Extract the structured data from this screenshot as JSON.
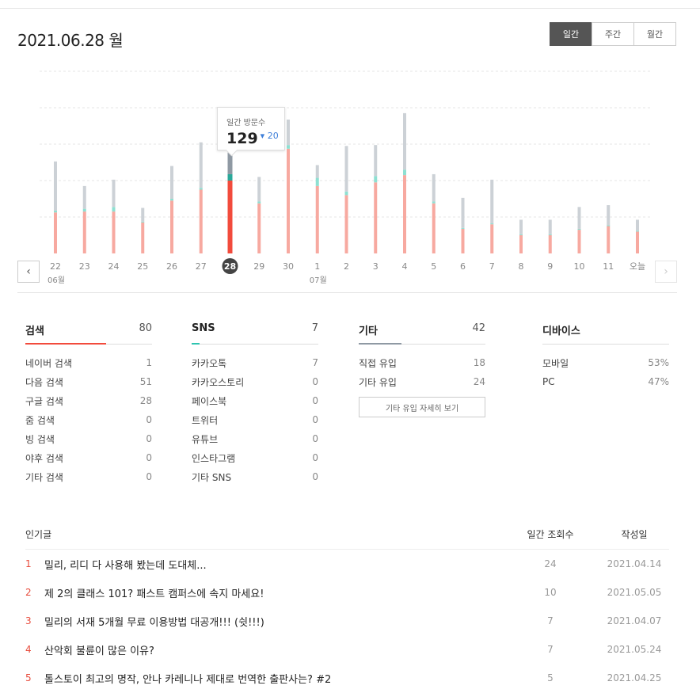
{
  "header": {
    "date_title": "2021.06.28 월",
    "periods": [
      "일간",
      "주간",
      "월간"
    ],
    "active_period": 0
  },
  "colors": {
    "search": "#f7a9a0",
    "search_selected": "#f24b3c",
    "sns": "#8ee0d2",
    "sns_selected": "#2aa89a",
    "other": "#ccd1d6",
    "other_selected": "#8f99a3",
    "grid": "#e6e6e6"
  },
  "tooltip": {
    "label": "일간 방문수",
    "value": "129",
    "change": "20",
    "change_arrow": "▾"
  },
  "chart_data": {
    "type": "bar",
    "stacked": true,
    "categories": [
      "22",
      "23",
      "24",
      "25",
      "26",
      "27",
      "28",
      "29",
      "30",
      "1",
      "2",
      "3",
      "4",
      "5",
      "6",
      "7",
      "8",
      "9",
      "10",
      "11",
      "오늘"
    ],
    "month_labels": [
      {
        "index": 0,
        "label": "06월"
      },
      {
        "index": 9,
        "label": "07월"
      }
    ],
    "selected_index": 6,
    "ylim": [
      0,
      200
    ],
    "grid": true,
    "series": [
      {
        "key": "search",
        "values": [
          45,
          46,
          46,
          34,
          58,
          70,
          80,
          55,
          115,
          74,
          64,
          78,
          86,
          55,
          27,
          32,
          20,
          20,
          26,
          30,
          24
        ]
      },
      {
        "key": "sns",
        "values": [
          2,
          3,
          5,
          1,
          2,
          2,
          7,
          2,
          4,
          9,
          4,
          7,
          6,
          2,
          1,
          1,
          1,
          1,
          1,
          1,
          1
        ]
      },
      {
        "key": "other",
        "values": [
          54,
          25,
          30,
          15,
          36,
          50,
          42,
          27,
          28,
          14,
          50,
          34,
          62,
          30,
          33,
          48,
          16,
          16,
          24,
          22,
          12
        ]
      }
    ]
  },
  "stats": {
    "search": {
      "title": "검색",
      "total": "80",
      "rows": [
        {
          "label": "네이버 검색",
          "value": "1"
        },
        {
          "label": "다음 검색",
          "value": "51"
        },
        {
          "label": "구글 검색",
          "value": "28"
        },
        {
          "label": "줌 검색",
          "value": "0"
        },
        {
          "label": "빙 검색",
          "value": "0"
        },
        {
          "label": "야후 검색",
          "value": "0"
        },
        {
          "label": "기타 검색",
          "value": "0"
        }
      ]
    },
    "sns": {
      "title": "SNS",
      "total": "7",
      "rows": [
        {
          "label": "카카오톡",
          "value": "7"
        },
        {
          "label": "카카오스토리",
          "value": "0"
        },
        {
          "label": "페이스북",
          "value": "0"
        },
        {
          "label": "트위터",
          "value": "0"
        },
        {
          "label": "유튜브",
          "value": "0"
        },
        {
          "label": "인스타그램",
          "value": "0"
        },
        {
          "label": "기타 SNS",
          "value": "0"
        }
      ]
    },
    "other": {
      "title": "기타",
      "total": "42",
      "rows": [
        {
          "label": "직접 유입",
          "value": "18"
        },
        {
          "label": "기타 유입",
          "value": "24"
        }
      ],
      "more_label": "기타 유입 자세히 보기"
    },
    "device": {
      "title": "디바이스",
      "rows": [
        {
          "label": "모바일",
          "value": "53%"
        },
        {
          "label": "PC",
          "value": "47%"
        }
      ]
    }
  },
  "popular": {
    "header": {
      "title": "인기글",
      "views": "일간 조회수",
      "date": "작성일"
    },
    "rows": [
      {
        "rank": "1",
        "title": "밀리, 리디 다 사용해 봤는데 도대체...",
        "views": "24",
        "date": "2021.04.14"
      },
      {
        "rank": "2",
        "title": "제 2의 클래스 101? 패스트 캠퍼스에 속지 마세요!",
        "views": "10",
        "date": "2021.05.05"
      },
      {
        "rank": "3",
        "title": "밀리의 서재 5개월 무료 이용방법 대공개!!! (쉿!!!)",
        "views": "7",
        "date": "2021.04.07"
      },
      {
        "rank": "4",
        "title": "산악회 불륜이 많은 이유?",
        "views": "7",
        "date": "2021.05.24"
      },
      {
        "rank": "5",
        "title": "톨스토이 최고의 명작, 안나 카레니나 제대로 번역한 출판사는? #2",
        "views": "5",
        "date": "2021.04.25"
      }
    ]
  }
}
